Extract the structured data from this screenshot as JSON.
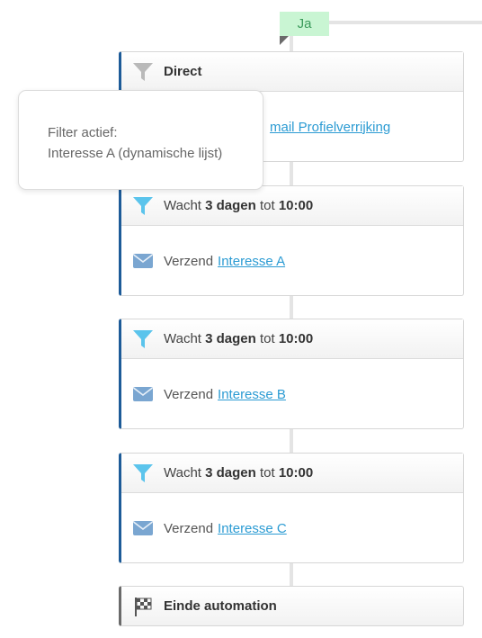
{
  "branch": {
    "label": "Ja"
  },
  "direct_step": {
    "title": "Direct",
    "action_link": "E-mail Profielverrijking",
    "action_link_visible": "mail Profielverrijking"
  },
  "tooltip": {
    "line1": "Filter actief:",
    "line2": "Interesse A (dynamische lijst)"
  },
  "steps": [
    {
      "wait_prefix": "Wacht",
      "duration": "3 dagen",
      "tot": "tot",
      "time": "10:00",
      "send_prefix": "Verzend",
      "mail": "Interesse A"
    },
    {
      "wait_prefix": "Wacht",
      "duration": "3 dagen",
      "tot": "tot",
      "time": "10:00",
      "send_prefix": "Verzend",
      "mail": "Interesse B"
    },
    {
      "wait_prefix": "Wacht",
      "duration": "3 dagen",
      "tot": "tot",
      "time": "10:00",
      "send_prefix": "Verzend",
      "mail": "Interesse C"
    }
  ],
  "end": {
    "label": "Einde automation"
  },
  "icons": {
    "filter_gray": "filter-icon",
    "filter_active": "filter-icon",
    "mail": "envelope-icon",
    "end": "checkered-flag-icon"
  },
  "colors": {
    "accent_blue": "#1d5b98",
    "link": "#2b9bd3",
    "filter_icon": "#5bc4ec",
    "branch_bg": "#c9f5d3"
  }
}
